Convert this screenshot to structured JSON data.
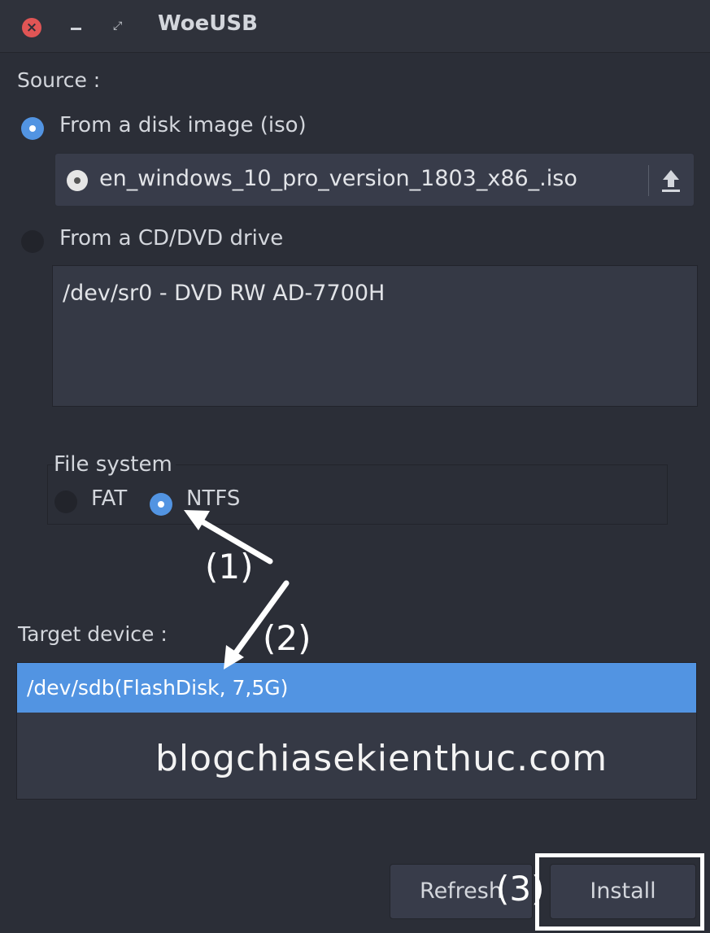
{
  "window": {
    "title": "WoeUSB"
  },
  "source": {
    "label": "Source :",
    "iso_option": "From a disk image (iso)",
    "iso_file": "en_windows_10_pro_version_1803_x86_.iso",
    "dvd_option": "From a CD/DVD drive",
    "dvd_drives": [
      "/dev/sr0 - DVD RW AD-7700H"
    ]
  },
  "file_system": {
    "label": "File system",
    "options": [
      "FAT",
      "NTFS"
    ],
    "selected": "NTFS"
  },
  "target": {
    "label": "Target device :",
    "devices": [
      "/dev/sdb(FlashDisk, 7,5G)"
    ]
  },
  "watermark": "blogchiasekienthuc.com",
  "buttons": {
    "refresh": "Refresh",
    "install": "Install"
  },
  "annotations": {
    "step1": "(1)",
    "step2": "(2)",
    "step3": "(3)"
  },
  "colors": {
    "accent": "#5294e2",
    "background": "#2b2e37",
    "close": "#e05555"
  }
}
